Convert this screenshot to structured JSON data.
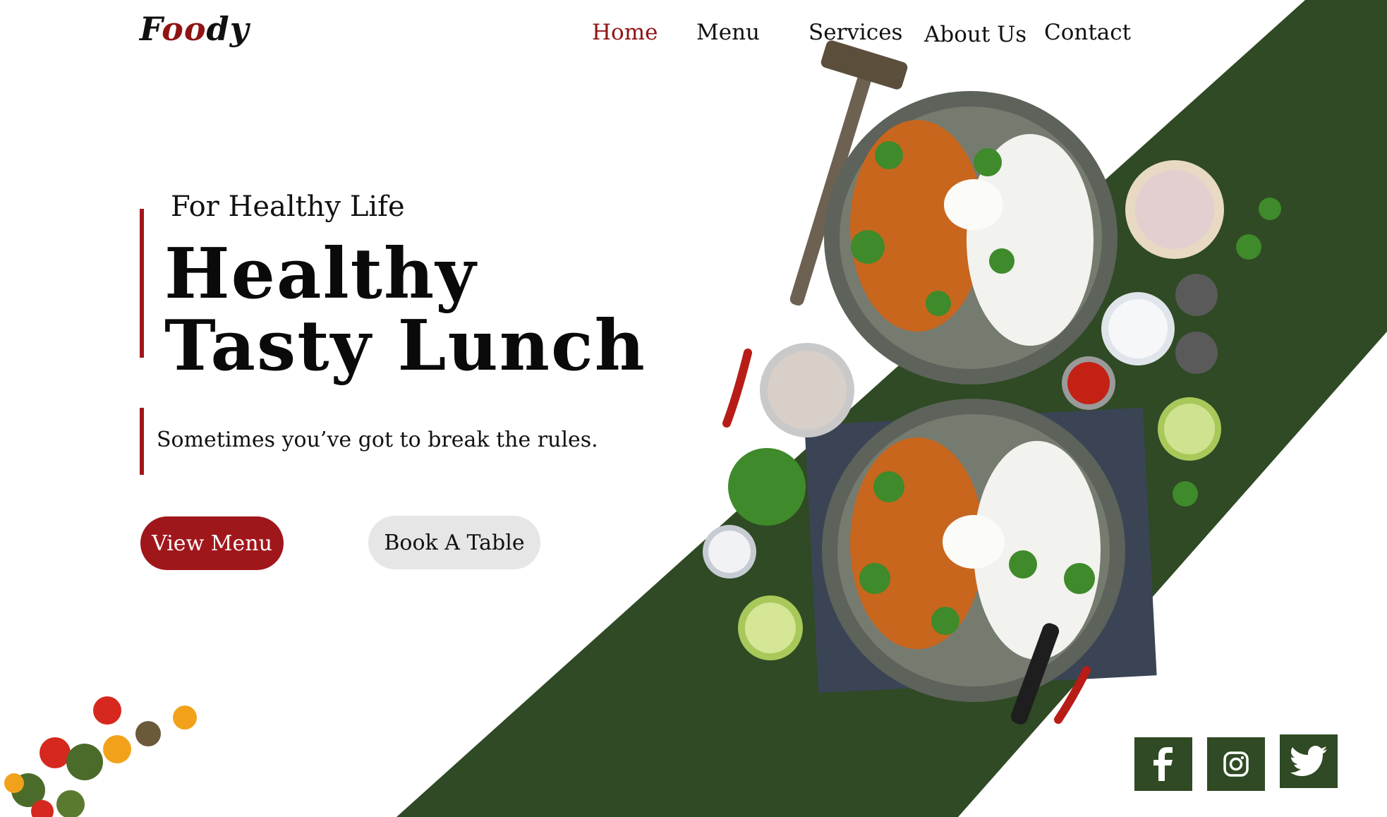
{
  "brand": {
    "logo_start": "F",
    "logo_accent": "oo",
    "logo_end": "dy"
  },
  "nav": {
    "items": [
      {
        "label": "Home",
        "active": true
      },
      {
        "label": "Menu",
        "active": false
      },
      {
        "label": "Services",
        "active": false
      },
      {
        "label": "About Us",
        "active": false
      },
      {
        "label": "Contact",
        "active": false
      }
    ]
  },
  "hero": {
    "tagline": "For Healthy Life",
    "headline_line1": "Healthy",
    "headline_line2": "Tasty Lunch",
    "subline": "Sometimes you’ve got to break the rules."
  },
  "buttons": {
    "primary": "View Menu",
    "secondary": "Book A Table"
  },
  "social": [
    {
      "icon": "facebook-icon"
    },
    {
      "icon": "instagram-icon"
    },
    {
      "icon": "twitter-icon"
    }
  ],
  "colors": {
    "accent": "#a0171b",
    "band": "#2f4a24",
    "button_secondary": "#e6e6e6"
  }
}
